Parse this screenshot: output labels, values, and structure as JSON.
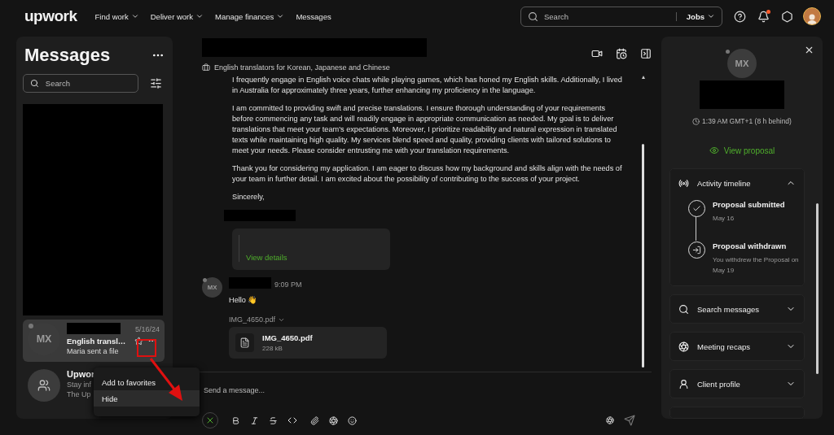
{
  "nav": {
    "logo": "upwork",
    "items": [
      {
        "label": "Find work",
        "dropdown": true
      },
      {
        "label": "Deliver work",
        "dropdown": true
      },
      {
        "label": "Manage finances",
        "dropdown": true
      },
      {
        "label": "Messages",
        "dropdown": false
      }
    ],
    "search": {
      "placeholder": "Search",
      "scope": "Jobs"
    },
    "notifications_unread": true
  },
  "sidebar": {
    "title": "Messages",
    "search": {
      "placeholder": "Search"
    },
    "conversations": [
      {
        "kind": "contact",
        "initials": "MX",
        "date": "5/16/24",
        "title": "English transl…",
        "preview": "Maria sent a file",
        "selected": true
      },
      {
        "kind": "group",
        "title": "Upwor",
        "preview": "Stay inf",
        "line_3": "The Up",
        "selected": false
      }
    ]
  },
  "context_menu": {
    "items": [
      {
        "label": "Add to favorites",
        "highlighted": false
      },
      {
        "label": "Hide",
        "highlighted": true
      }
    ]
  },
  "chat": {
    "job": "English translators for Korean, Japanese and Chinese",
    "paragraphs": [
      "I frequently engage in English voice chats while playing games, which has honed my English skills. Additionally, I lived in Australia for approximately three years, further enhancing my proficiency in the language.",
      "I am committed to providing swift and precise translations. I ensure thorough understanding of your requirements before commencing any task and will readily engage in appropriate communication as needed. My goal is to deliver translations that meet your team's expectations. Moreover, I prioritize readability and natural expression in translated texts while maintaining high quality. My services blend speed and quality, providing clients with tailored solutions to meet your needs. Please consider entrusting me with your translation requirements.",
      "Thank you for considering my application. I am eager to discuss how my background and skills align with the needs of your team in further detail. I am excited about the possibility of contributing to the success of your project.",
      "Sincerely,"
    ],
    "proposal_link": "View details",
    "message": {
      "initials": "MX",
      "time": "9:09 PM",
      "text": "Hello 👋",
      "attachment_label": "IMG_4650.pdf",
      "file_name": "IMG_4650.pdf",
      "file_size": "228 kB"
    },
    "composer": {
      "placeholder": "Send a message..."
    }
  },
  "details": {
    "initials": "MX",
    "local_time": "1:39 AM GMT+1 (8 h behind)",
    "view_proposal": "View proposal",
    "timeline": {
      "title": "Activity timeline",
      "expanded": true,
      "events": [
        {
          "kind": "submitted",
          "title": "Proposal submitted",
          "detail": "May 16"
        },
        {
          "kind": "withdrawn",
          "title": "Proposal withdrawn",
          "detail": "You withdrew the Proposal on May 19"
        }
      ]
    },
    "sections": [
      {
        "kind": "search",
        "label": "Search messages",
        "expanded": false
      },
      {
        "kind": "meetings",
        "label": "Meeting recaps",
        "expanded": false
      },
      {
        "kind": "client",
        "label": "Client profile",
        "expanded": false
      }
    ]
  }
}
